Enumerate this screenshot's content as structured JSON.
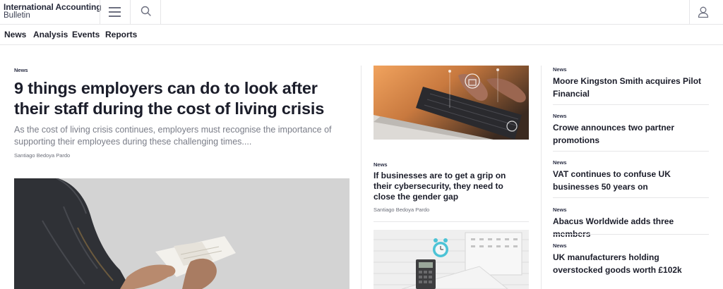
{
  "header": {
    "logo_line1": "International Accounting",
    "logo_line2": "Bulletin",
    "menu_icon": "hamburger-menu-icon",
    "search_icon": "search-icon",
    "account_icon": "user-account-icon"
  },
  "nav": {
    "items": [
      {
        "label": "News"
      },
      {
        "label": "Analysis"
      },
      {
        "label": "Events"
      },
      {
        "label": "Reports"
      }
    ]
  },
  "lead": {
    "tag": "News",
    "title": "9 things employers can do to look after their staff during the cost of living crisis",
    "excerpt": "As the cost of living crisis continues, employers must recognise the importance of supporting their employees during these challenging times....",
    "author": "Santiago Bedoya Pardo"
  },
  "middle": {
    "tag": "News",
    "title": "If businesses are to get a grip on their cybersecurity, they need to close the gender gap",
    "author": "Santiago Bedoya Pardo"
  },
  "right": {
    "items": [
      {
        "tag": "News",
        "title": "Moore Kingston Smith acquires Pilot Financial"
      },
      {
        "tag": "News",
        "title": "Crowe announces two partner promotions"
      },
      {
        "tag": "News",
        "title": "VAT continues to confuse UK businesses 50 years on"
      },
      {
        "tag": "News",
        "title": "Abacus Worldwide adds three members"
      },
      {
        "tag": "News",
        "title": "UK manufacturers holding overstocked goods worth £102k"
      }
    ]
  },
  "colors": {
    "text": "#1d1f2b",
    "muted": "#7a7d88",
    "divider": "#e6e6e8"
  }
}
